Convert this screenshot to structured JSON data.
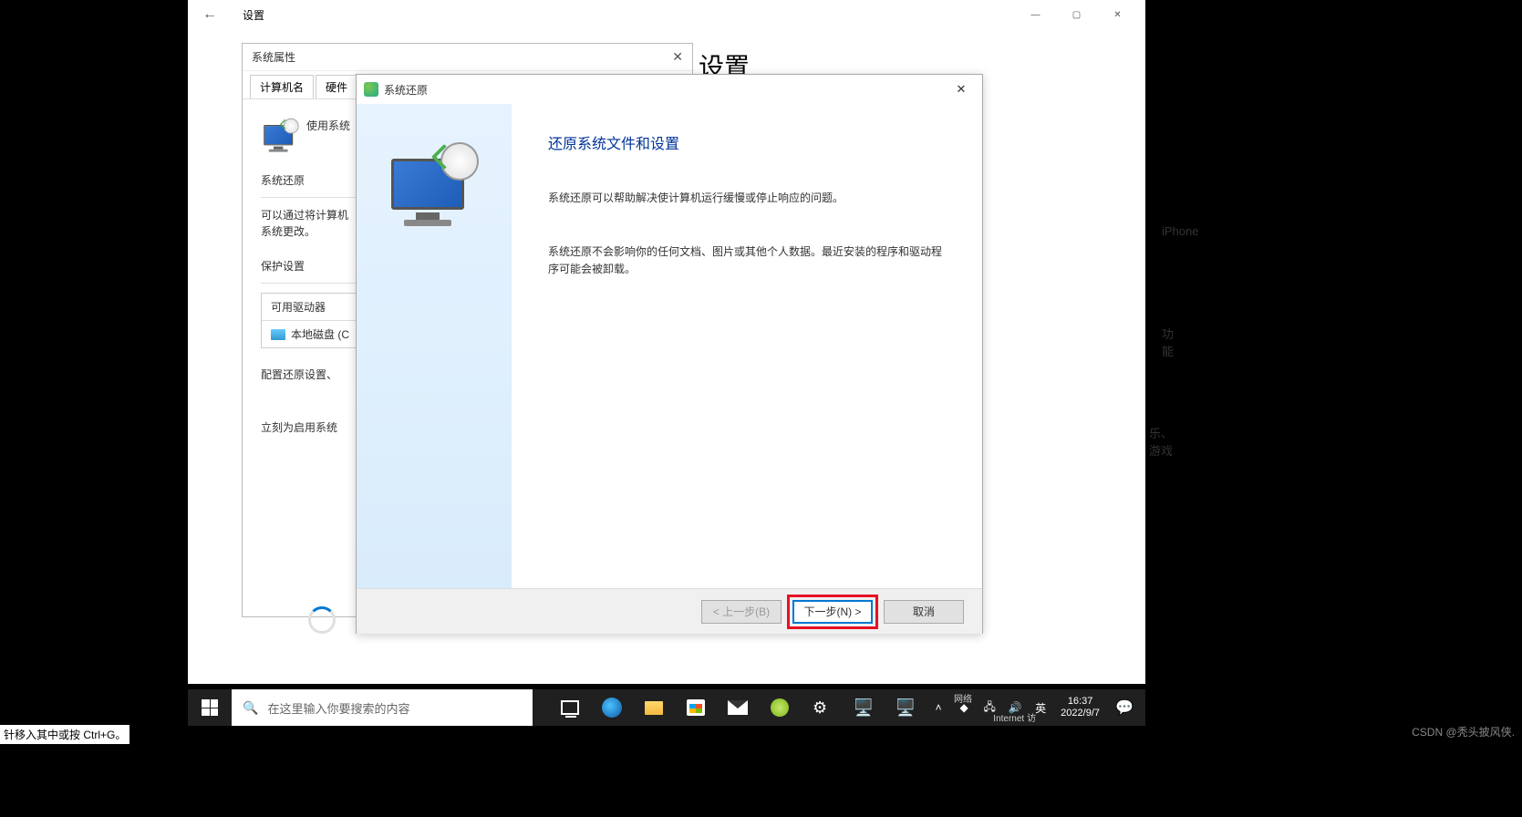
{
  "settings": {
    "title": "设置",
    "heading": "设置",
    "side1": "iPhone",
    "side2": "功能",
    "side3": "乐、游戏"
  },
  "sysprops": {
    "title": "系统属性",
    "tabs": [
      "计算机名",
      "硬件"
    ],
    "use_restore_hint": "使用系统",
    "section_restore": "系统还原",
    "restore_desc": "可以通过将计算机\n系统更改。",
    "section_protect": "保护设置",
    "available_drivers": "可用驱动器",
    "local_disk": "本地磁盘 (C",
    "config_text": "配置还原设置、",
    "enable_text": "立刻为启用系统"
  },
  "wizard": {
    "title": "系统还原",
    "heading": "还原系统文件和设置",
    "para1": "系统还原可以帮助解决使计算机运行缓慢或停止响应的问题。",
    "para2": "系统还原不会影响你的任何文档、图片或其他个人数据。最近安装的程序和驱动程序可能会被卸载。",
    "btn_back": "< 上一步(B)",
    "btn_next": "下一步(N) >",
    "btn_cancel": "取消"
  },
  "taskbar": {
    "search_placeholder": "在这里输入你要搜索的内容",
    "time": "16:37",
    "date": "2022/9/7",
    "ime": "英",
    "network": "网络",
    "internet": "Internet 访"
  },
  "footer_hint": "针移入其中或按 Ctrl+G。",
  "watermark": "CSDN @秃头披风侠."
}
